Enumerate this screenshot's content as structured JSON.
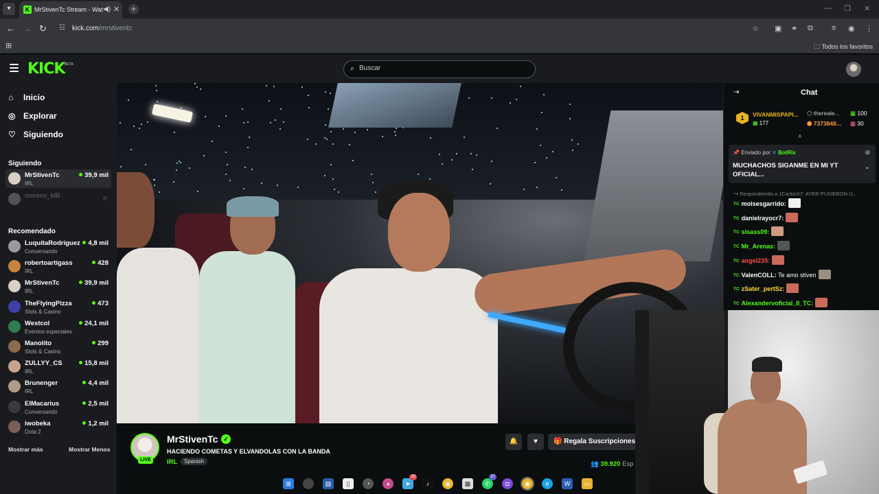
{
  "browser": {
    "tab_title": "MrStivenTc Stream - Watch",
    "url_host": "kick.com",
    "url_path": "/mrstiventc",
    "favorites_label": "Todos los favoritos"
  },
  "header": {
    "logo": "KICK",
    "beta": "BETA",
    "search_placeholder": "Buscar"
  },
  "sidebar": {
    "nav": [
      {
        "label": "Inicio",
        "icon": "home-icon"
      },
      {
        "label": "Explorar",
        "icon": "compass-icon"
      },
      {
        "label": "Siguiendo",
        "icon": "heart-icon"
      }
    ],
    "following_title": "Siguiendo",
    "following": [
      {
        "name": "MrStivenTc",
        "category": "IRL",
        "viewers": "39,9 mil",
        "active": true,
        "online": true,
        "color": "#d8cfc6"
      },
      {
        "name": "moreno_MB",
        "category": "",
        "viewers": "",
        "active": false,
        "online": false,
        "color": "#8a8a8a"
      }
    ],
    "recommended_title": "Recomendado",
    "recommended": [
      {
        "name": "LuquitaRodriguez",
        "category": "Conversando",
        "viewers": "4,8 mil",
        "color": "#9a9a9a"
      },
      {
        "name": "robertoartigass",
        "category": "IRL",
        "viewers": "428",
        "color": "#c8833f"
      },
      {
        "name": "MrStivenTc",
        "category": "IRL",
        "viewers": "39,9 mil",
        "color": "#d8cfc6"
      },
      {
        "name": "TheFlyingPizza",
        "category": "Slots & Casino",
        "viewers": "473",
        "color": "#3f3fa8"
      },
      {
        "name": "Westcol",
        "category": "Eventos especiales",
        "viewers": "24,1 mil",
        "color": "#2f7d4d"
      },
      {
        "name": "Manolito",
        "category": "Slots & Casino",
        "viewers": "299",
        "color": "#8c6a4e"
      },
      {
        "name": "ZULLYY_CS",
        "category": "IRL",
        "viewers": "15,8 mil",
        "color": "#c9a48d"
      },
      {
        "name": "Brunenger",
        "category": "IRL",
        "viewers": "4,4 mil",
        "color": "#b09a8a"
      },
      {
        "name": "ElMacarius",
        "category": "Conversando",
        "viewers": "2,5 mil",
        "color": "#3a3a3a"
      },
      {
        "name": "iwobeka",
        "category": "Dota 2",
        "viewers": "1,2 mil",
        "color": "#7a5f58"
      }
    ],
    "show_more": "Mostrar más",
    "show_less": "Mostrar Menos"
  },
  "stream": {
    "streamer": "MrStivenTc",
    "live": "LIVE",
    "title": "HACIENDO COMETAS Y ELVANDOLAS CON LA BANDA",
    "category": "IRL",
    "language": "Spanish",
    "gift_label": "Regala Suscripciones",
    "viewers": "39.920",
    "viewers_suffix": "Esp"
  },
  "chat": {
    "title": "Chat",
    "leaderboard": {
      "rank": "1",
      "top_name": "VIVANMISPAPI...",
      "top_score": "177",
      "second_name": "thereale...",
      "second_score": "7373848...",
      "count1": "100",
      "count2": "30"
    },
    "pinned": {
      "sent_by_prefix": "Enviado por",
      "sent_by": "BotRix",
      "message": "MUCHACHOS SIGANME EN MI YT OFICIAL..."
    },
    "reply_to": "Respondiendo a 1CarlosX7: AYER PUSIERON U...",
    "messages": [
      {
        "user": "moisesgarrido:",
        "text": "",
        "color": "#ffffff",
        "emote": "#f0f0f0"
      },
      {
        "user": "danielrayocr7:",
        "text": "",
        "color": "#ffffff",
        "emote": "#c86b5a"
      },
      {
        "user": "sisass09:",
        "text": "",
        "color": "#53fc18",
        "emote": "#d09a80"
      },
      {
        "user": "Mr_Arenas:",
        "text": "",
        "color": "#53fc18",
        "emote": "#555555"
      },
      {
        "user": "angel235:",
        "text": "",
        "color": "#ff4d4d",
        "emote": "#c86b5a"
      },
      {
        "user": "ValenCOLL:",
        "text": "Te amo stiven",
        "color": "#ffffff",
        "emote": "#9a8f80"
      },
      {
        "user": "zSater_pertSz:",
        "text": "",
        "color": "#ffd93c",
        "emote": "#c86b5a"
      },
      {
        "user": "Alexandervoficial_II_TC:",
        "text": "",
        "color": "#53fc18",
        "emote": "#c86b5a"
      }
    ],
    "badge": "TC"
  },
  "taskbar": {
    "badge_telegram": "33",
    "badge_whatsapp": "37"
  }
}
